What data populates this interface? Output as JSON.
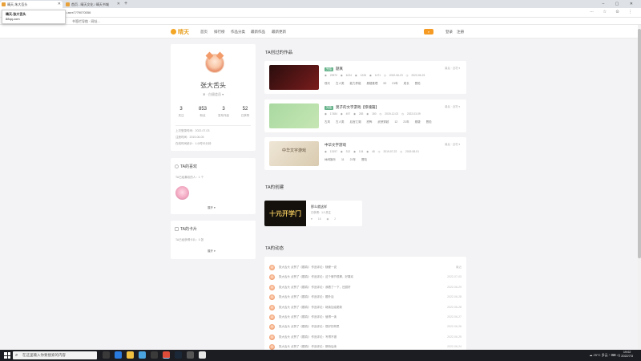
{
  "browser": {
    "tabs": [
      {
        "label": "晴天-朱大吾头",
        "active": true
      },
      {
        "label": "首页 - 晴天文化 / 晴天书城",
        "active": false
      }
    ],
    "new_tab": "+",
    "url": "...user/7/79070056",
    "toolbar_icons": "◁ ▷ ↻",
    "bookmark": "书签栏导航 · 网址...",
    "hover_popup": {
      "title": "晴天-张大舌头",
      "url": "88qq.com"
    },
    "window_controls": "–  ▢  ✕"
  },
  "site": {
    "logo": "晴天",
    "nav": [
      "首页",
      "排行榜",
      "作品分类",
      "最新作品",
      "最新更新"
    ],
    "search_icon": "search-icon",
    "login": "登录",
    "register": "注册"
  },
  "profile": {
    "name": "张大舌头",
    "level": "♛ · 白银会员 ▾",
    "stats": [
      {
        "value": "3",
        "label": "关注"
      },
      {
        "value": "853",
        "label": "粉丝"
      },
      {
        "value": "3",
        "label": "发布作品"
      },
      {
        "value": "52",
        "label": "已获赞"
      }
    ],
    "meta": [
      "上次登录时间：2022-07-03",
      "注册时间：2019-06-05",
      "在线时间统计：1小时52分钟"
    ]
  },
  "likes": {
    "heading": "TA的喜欢",
    "count_text": "TA已经喜欢的人：1 个",
    "more": "展开 ▾"
  },
  "cards": {
    "heading": "TA的卡片",
    "count_text": "TA已经获得卡片：0 张",
    "more": "展开 ▾"
  },
  "works": {
    "heading": "TA创过的作品",
    "items": [
      {
        "badge": "完结",
        "title": "题真",
        "stats": "◉ 29570  ◉ 4024  ◉ 1226  ◉ 1471  ◷ 2022-06-23  ◷ 2022-06-23",
        "tags": "现代  古人类  能力异能  悬疑推理  92  21年  成长  冒险",
        "ctrl": "最后 · 近况 ▾",
        "thumb_colors": [
          "#2a0d0d",
          "#7a1c1c"
        ]
      },
      {
        "badge": "完结",
        "title": "莫子的文字游戏【惊魂篇】",
        "stats": "◉ 17484  ◉ 497  ◉ 283  ◉ 150  ◷ 2019-12-02  ◷ 2022-03-09",
        "tags": "古风  古人类  后宫江湖  恐怖  武侠穿越  12  21年  悬疑  冒险",
        "ctrl": "最后 · 近况 ▾",
        "thumb_colors": [
          "#a9d9a0",
          "#c6e6b3"
        ]
      },
      {
        "badge": "",
        "title": "中华文字游戏",
        "stats": "◉ 13197  ◉ 312  ◉ 104  ◉ 48  ◷ 2019-07-22  ◷ 2019-08-01",
        "tags": "休闲娱乐  11  21年  冒险",
        "ctrl": "最后 · 近况 ▾",
        "thumb_colors": [
          "#efe6d6",
          "#d9cbb0"
        ],
        "thumb_text": "中华文字游戏"
      }
    ]
  },
  "creation": {
    "heading": "TA的创建",
    "thumb_text": "十元开学门",
    "title": "那么就这样",
    "subtitle": "已获得：1人关注",
    "stats": "♥ 16  ◉ 2"
  },
  "activity": {
    "heading": "TA的动态",
    "rows": [
      {
        "text": "张大舌头  点赞了《题真》 作品评论：随便一说",
        "date": "最近"
      },
      {
        "text": "张大舌头  点赞了《题真》 作品评论：这个情节很棒，好喜欢",
        "date": "2022-07-03"
      },
      {
        "text": "张大舌头  点赞了《题真》 作品评论：我看了一下，还挺好",
        "date": "2022-06-29"
      },
      {
        "text": "张大舌头  点赞了《题真》 作品评论：题外话",
        "date": "2022-06-28"
      },
      {
        "text": "张大舌头  点赞了《题真》 作品评论：继续加油更新",
        "date": "2022-06-28"
      },
      {
        "text": "张大舌头  点赞了《题真》 作品评论：值得一读",
        "date": "2022-06-27"
      },
      {
        "text": "张大舌头  点赞了《题真》 作品评论：很好的构思",
        "date": "2022-06-26"
      },
      {
        "text": "张大舌头  点赞了《题真》 作品评论：写得不错",
        "date": "2022-06-25"
      },
      {
        "text": "张大舌头  点赞了《题真》 作品评论：期待后续",
        "date": "2022-06-24"
      }
    ]
  },
  "taskbar": {
    "search_placeholder": "在这里输入你要搜索的内容",
    "tray": "☁ 25°C 多云  ^  ⌨  ◁)",
    "time": "19:02",
    "date": "2022/7/3"
  }
}
